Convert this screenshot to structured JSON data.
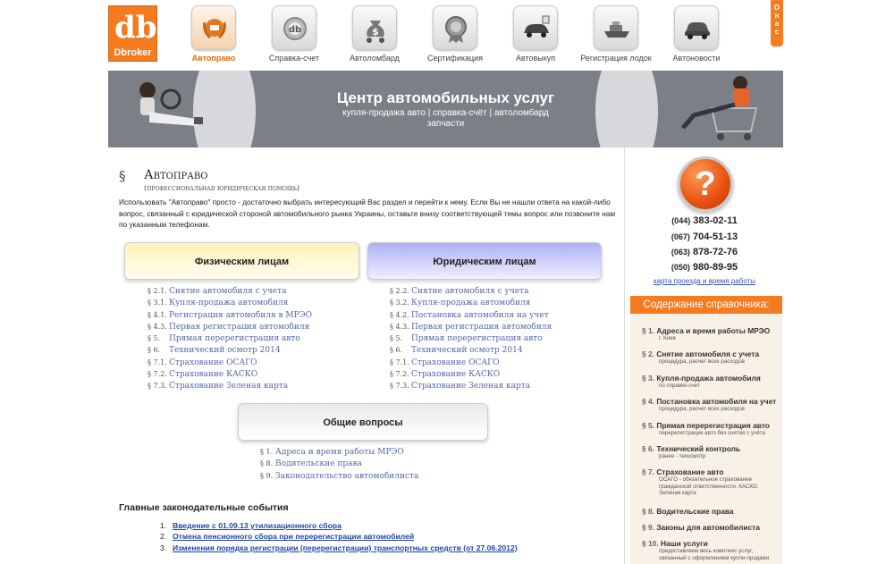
{
  "logo": {
    "mark": "db",
    "brand": "Dbroker"
  },
  "nav": [
    {
      "label": "Автоправо",
      "icon": "laurel-badge-icon",
      "active": true
    },
    {
      "label": "Справка-счет",
      "icon": "document-badge-icon",
      "active": false
    },
    {
      "label": "Автоломбард",
      "icon": "money-bag-icon",
      "active": false
    },
    {
      "label": "Сертификация",
      "icon": "certificate-seal-icon",
      "active": false
    },
    {
      "label": "Автовыкуп",
      "icon": "car-price-icon",
      "active": false
    },
    {
      "label": "Регистрация лодок",
      "icon": "boat-icon",
      "active": false
    },
    {
      "label": "Автоновости",
      "icon": "car-icon",
      "active": false
    }
  ],
  "about_tab": "О нас",
  "banner": {
    "title": "Центр автомобильных услуг",
    "subtitle": "купля-продажа авто | справка-счёт | автоломбард",
    "subtitle2": "запчасти"
  },
  "main": {
    "section_sign": "§",
    "title": "Автоправо",
    "subtitle": "(профессиональная юридическая помощь)",
    "intro": "Использовать \"Автоправо\" просто - достаточно выбрать интересующий Вас раздел и перейти к нему. Если Вы не нашли ответа на какой-либо вопрос, связанный с юридической стороной автомобильного рынка Украины, оставьте внизу соответствующей темы вопрос или позвоните нам по указанным телефонам.",
    "individuals": {
      "label": "Физическим лицам",
      "links": [
        {
          "num": "§ 2.1.",
          "text": "Снятие автомобиля с учета"
        },
        {
          "num": "§ 3.1.",
          "text": "Купля-продажа автомобиля"
        },
        {
          "num": "§ 4.1.",
          "text": "Регистрация автомобиля в МРЭО"
        },
        {
          "num": "§ 4.3.",
          "text": "Первая регистрация автомобиля"
        },
        {
          "num": "§ 5.",
          "text": "Прямая перерегистрация авто"
        },
        {
          "num": "§ 6.",
          "text": "Технический осмотр 2014"
        },
        {
          "num": "§ 7.1.",
          "text": "Страхование ОСАГО"
        },
        {
          "num": "§ 7.2.",
          "text": "Страхование КАСКО"
        },
        {
          "num": "§ 7.3.",
          "text": "Страхование Зеленая карта"
        }
      ]
    },
    "legal": {
      "label": "Юридическим лицам",
      "links": [
        {
          "num": "§ 2.2.",
          "text": "Снятие автомобиля с учета"
        },
        {
          "num": "§ 3.2.",
          "text": "Купля-продажа автомобиля"
        },
        {
          "num": "§ 4.2.",
          "text": "Постановка автомобиля на учет"
        },
        {
          "num": "§ 4.3.",
          "text": "Первая регистрация автомобиля"
        },
        {
          "num": "§ 5.",
          "text": "Прямая перерегистрация авто"
        },
        {
          "num": "§ 6.",
          "text": "Технический осмотр 2014"
        },
        {
          "num": "§ 7.1.",
          "text": "Страхование ОСАГО"
        },
        {
          "num": "§ 7.2.",
          "text": "Страхование КАСКО"
        },
        {
          "num": "§ 7.3.",
          "text": "Страхование Зеленая карта"
        }
      ]
    },
    "general": {
      "label": "Общие вопросы",
      "links": [
        {
          "num": "§ 1.",
          "text": "Адреса и время работы МРЭО"
        },
        {
          "num": "§ 8.",
          "text": "Водительские права"
        },
        {
          "num": "§ 9.",
          "text": "Законодательство автомобилиста"
        }
      ]
    },
    "events_title": "Главные законодательные события",
    "events": [
      {
        "num": "1.",
        "text": "Введение с 01.09.13 утилизационного сбора"
      },
      {
        "num": "2.",
        "text": "Отмена пенсионного сбора при перерегистрации автомобилей"
      },
      {
        "num": "3.",
        "text": "Изменения порядка регистрации (перерегистрации) транспортных средств (от 27.06.2012)"
      }
    ]
  },
  "sidebar": {
    "help_symbol": "?",
    "phones": [
      {
        "code": "(044)",
        "number": "383-02-11"
      },
      {
        "code": "(067)",
        "number": "704-51-13"
      },
      {
        "code": "(063)",
        "number": "878-72-76"
      },
      {
        "code": "(050)",
        "number": "980-89-95"
      }
    ],
    "map_link": "карта проезда и время работы",
    "contents_title": "Содержание справочника:",
    "toc": [
      {
        "num": "§ 1.",
        "title": "Адреса и время работы МРЭО",
        "desc": "г. Киев"
      },
      {
        "num": "§ 2.",
        "title": "Снятие автомобиля с учета",
        "desc": "процедура, расчет всех расходов"
      },
      {
        "num": "§ 3.",
        "title": "Купля-продажа автомобиля",
        "desc": "по справке-счет"
      },
      {
        "num": "§ 4.",
        "title": "Постановка автомобиля на учет",
        "desc": "процедура, расчет всех расходов"
      },
      {
        "num": "§ 5.",
        "title": "Прямая перерегистрация авто",
        "desc": "перерегистрация авто без снятия с учёта"
      },
      {
        "num": "§ 6.",
        "title": "Технический контроль",
        "desc": "ранее - техосмотр"
      },
      {
        "num": "§ 7.",
        "title": "Страхование авто",
        "desc": "ОСАГО - обязательное страхование гражданской ответственности, КАСКО, Зеленая карта"
      },
      {
        "num": "§ 8.",
        "title": "Водительские права",
        "desc": ""
      },
      {
        "num": "§ 9.",
        "title": "Законы для автомобилиста",
        "desc": ""
      },
      {
        "num": "§ 10.",
        "title": "Наши услуги",
        "desc": "предоставляем весь комплекс услуг, связанный с оформлением купли-продажи"
      }
    ]
  },
  "colors": {
    "accent": "#f47b20",
    "link": "#5566aa",
    "banner": "#7b7f86"
  }
}
